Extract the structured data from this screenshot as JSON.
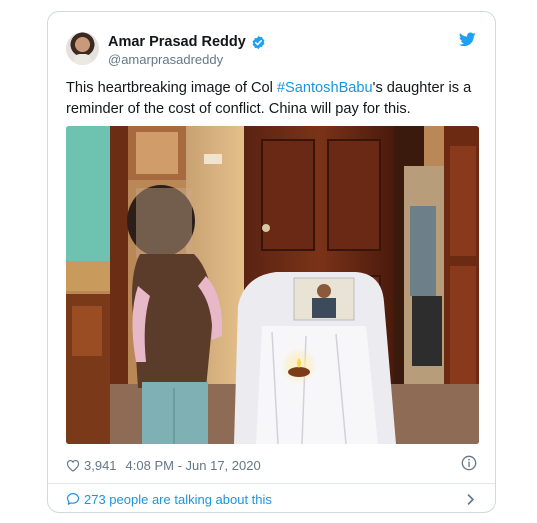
{
  "tweet": {
    "author_name": "Amar Prasad Reddy",
    "author_handle": "@amarprasadreddy",
    "text_before": "This heartbreaking image of Col ",
    "hashtag": "#SantoshBabu",
    "text_after": "'s daughter is a reminder of the cost of conflict. China will pay for this.",
    "likes": "3,941",
    "timestamp": "4:08 PM - Jun 17, 2020",
    "talking": "273 people are talking about this"
  },
  "colors": {
    "link": "#1b95e0",
    "verified": "#1da1f2",
    "muted": "#657786",
    "border": "#cfd9de"
  },
  "icons": [
    "verified-badge-icon",
    "twitter-logo-icon",
    "heart-icon",
    "info-icon",
    "speech-bubble-icon",
    "chevron-right-icon"
  ]
}
